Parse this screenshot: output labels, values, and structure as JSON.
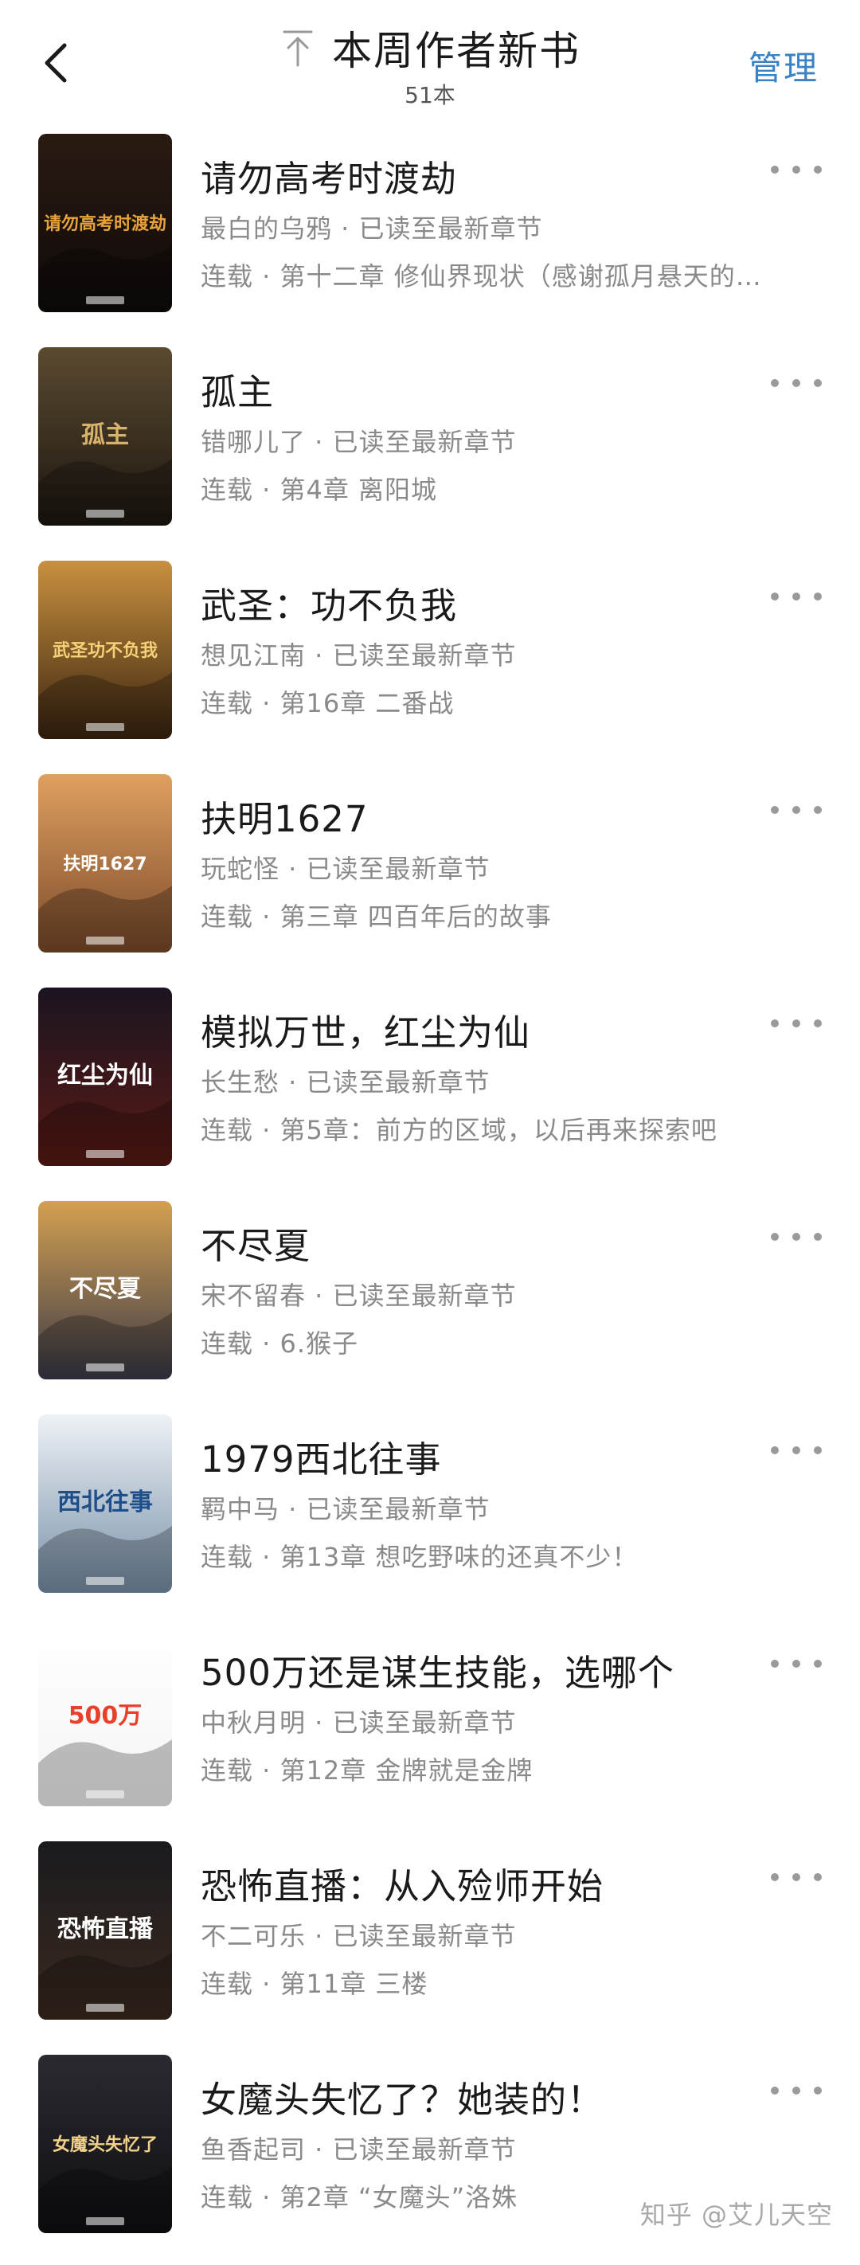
{
  "header": {
    "title": "本周作者新书",
    "count": "51本",
    "manage_label": "管理"
  },
  "books": [
    {
      "title": "请勿高考时渡劫",
      "meta": "最白的乌鸦 · 已读至最新章节",
      "chapter": "连载 · 第十二章 修仙界现状（感谢孤月悬天的…"
    },
    {
      "title": "孤主",
      "meta": "错哪儿了 · 已读至最新章节",
      "chapter": "连载 · 第4章 离阳城"
    },
    {
      "title": "武圣：功不负我",
      "meta": "想见江南 · 已读至最新章节",
      "chapter": "连载 · 第16章 二番战"
    },
    {
      "title": "扶明1627",
      "meta": "玩蛇怪 · 已读至最新章节",
      "chapter": "连载 · 第三章 四百年后的故事"
    },
    {
      "title": "模拟万世，红尘为仙",
      "meta": "长生愁 · 已读至最新章节",
      "chapter": "连载 · 第5章：前方的区域，以后再来探索吧"
    },
    {
      "title": "不尽夏",
      "meta": "宋不留春 · 已读至最新章节",
      "chapter": "连载 · 6.猴子"
    },
    {
      "title": "1979西北往事",
      "meta": "羁中马 · 已读至最新章节",
      "chapter": "连载 · 第13章 想吃野味的还真不少！"
    },
    {
      "title": "500万还是谋生技能，选哪个",
      "meta": "中秋月明 · 已读至最新章节",
      "chapter": "连载 · 第12章 金牌就是金牌"
    },
    {
      "title": "恐怖直播：从入殓师开始",
      "meta": "不二可乐 · 已读至最新章节",
      "chapter": "连载 · 第11章 三楼"
    },
    {
      "title": "女魔头失忆了？她装的！",
      "meta": "鱼香起司 · 已读至最新章节",
      "chapter": "连载 · 第2章 “女魔头”洛姝"
    }
  ],
  "covers": [
    {
      "text": "请勿高考时渡劫",
      "colors": [
        "#2a1a12",
        "#0e0a08"
      ],
      "accent": "#e8a23a"
    },
    {
      "text": "孤主",
      "colors": [
        "#5a4a30",
        "#1c1610"
      ],
      "accent": "#d8b26a"
    },
    {
      "text": "武圣功不负我",
      "colors": [
        "#c9913f",
        "#3a2410"
      ],
      "accent": "#f5d27a"
    },
    {
      "text": "扶明1627",
      "colors": [
        "#e0a060",
        "#7a4a2a"
      ],
      "accent": "#ffffff"
    },
    {
      "text": "红尘为仙",
      "colors": [
        "#1a1420",
        "#5a1a14"
      ],
      "accent": "#ffffff"
    },
    {
      "text": "不尽夏",
      "colors": [
        "#d4a050",
        "#3a3a48"
      ],
      "accent": "#ffffff"
    },
    {
      "text": "西北往事",
      "colors": [
        "#eef2f6",
        "#7890a8"
      ],
      "accent": "#1f4f8a"
    },
    {
      "text": "500万",
      "colors": [
        "#ffffff",
        "#f4f4f4"
      ],
      "accent": "#e8402a"
    },
    {
      "text": "恐怖直播",
      "colors": [
        "#1a1a1e",
        "#3a2a1e"
      ],
      "accent": "#ffffff"
    },
    {
      "text": "女魔头失忆了",
      "colors": [
        "#2a2a30",
        "#0e0e12"
      ],
      "accent": "#f0d08a"
    }
  ],
  "watermark": "知乎 @艾儿天空",
  "icons": {
    "back": "chevron-left-icon",
    "title": "arrow-up-bar-icon",
    "more": "more-dots-icon"
  }
}
